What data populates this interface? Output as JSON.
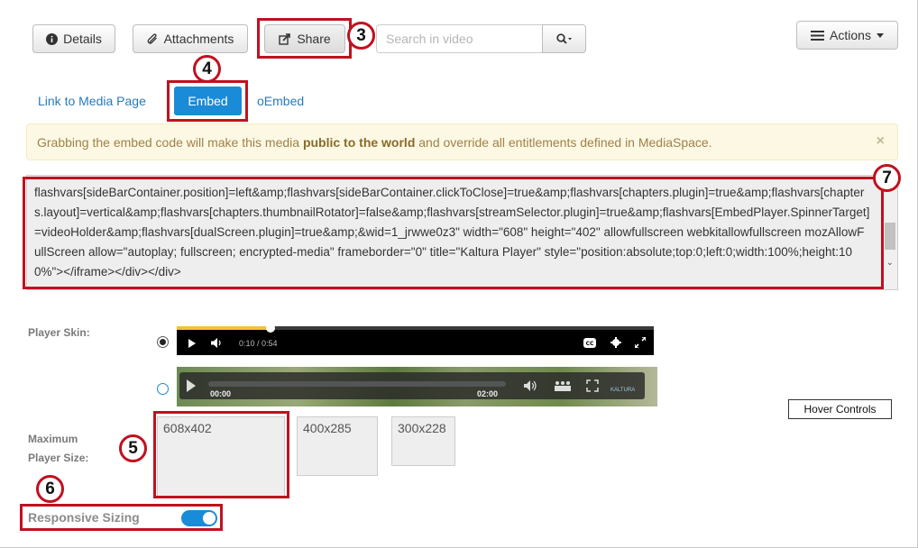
{
  "toolbar": {
    "details_label": "Details",
    "attachments_label": "Attachments",
    "share_label": "Share",
    "search_placeholder": "Search in video",
    "actions_label": "Actions"
  },
  "tabs": [
    {
      "label": "Link to Media Page",
      "active": false
    },
    {
      "label": "Embed",
      "active": true
    },
    {
      "label": "oEmbed",
      "active": false
    }
  ],
  "alert": {
    "prefix": "Grabbing the embed code will make this media ",
    "bold": "public to the world",
    "suffix": " and override all entitlements defined in MediaSpace.",
    "close": "×"
  },
  "embed_code": "flashvars[sideBarContainer.position]=left&amp;flashvars[sideBarContainer.clickToClose]=true&amp;flashvars[chapters.plugin]=true&amp;flashvars[chapters.layout]=vertical&amp;flashvars[chapters.thumbnailRotator]=false&amp;flashvars[streamSelector.plugin]=true&amp;flashvars[EmbedPlayer.SpinnerTarget]=videoHolder&amp;flashvars[dualScreen.plugin]=true&amp;&wid=1_jrwwe0z3\" width=\"608\" height=\"402\" allowfullscreen webkitallowfullscreen mozAllowFullScreen allow=\"autoplay; fullscreen; encrypted-media\" frameborder=\"0\" title=\"Kaltura Player\" style=\"position:absolute;top:0;left:0;width:100%;height:100%\"></iframe></div></div>",
  "player_skin": {
    "label": "Player Skin:",
    "skin1_time": "0:10 / 0:54",
    "skin1_progress": 0.2,
    "skin2_start": "00:00",
    "skin2_end": "02:00",
    "skin2_brand": "KALTURA",
    "selected": 1
  },
  "hover_controls": "Hover Controls",
  "max_size": {
    "label_line1": "Maximum",
    "label_line2": "Player Size:",
    "options": [
      "608x402",
      "400x285",
      "300x228"
    ],
    "selected": "608x402"
  },
  "responsive": {
    "label": "Responsive Sizing",
    "enabled": true
  },
  "annotations": [
    "3",
    "4",
    "5",
    "6",
    "7"
  ],
  "colors": {
    "accent": "#1a8bd6",
    "highlight": "#c0111f",
    "alert_bg": "#fcf8e3",
    "progress": "#f1c232"
  }
}
